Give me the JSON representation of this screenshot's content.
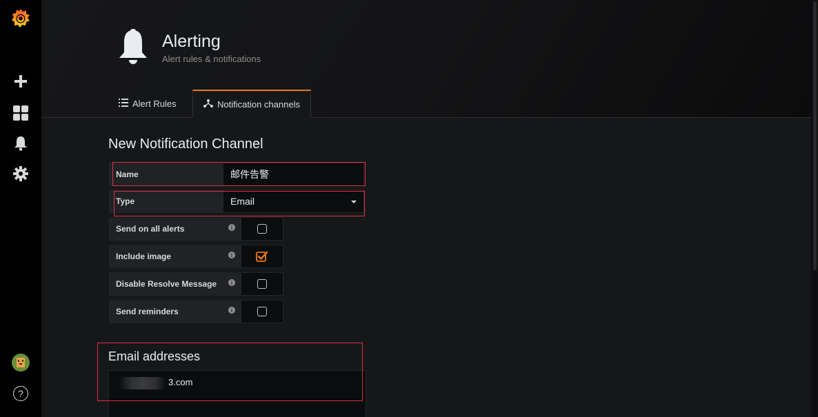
{
  "header": {
    "title": "Alerting",
    "subtitle": "Alert rules & notifications"
  },
  "tabs": [
    {
      "label": "Alert Rules",
      "icon": "list-icon",
      "active": false
    },
    {
      "label": "Notification channels",
      "icon": "share-icon",
      "active": true
    }
  ],
  "sidebar": {
    "items": [
      "grafana-logo",
      "plus-icon",
      "dashboards-icon",
      "bell-icon",
      "gear-icon",
      "avatar",
      "help-icon"
    ],
    "help_glyph": "?"
  },
  "form": {
    "title": "New Notification Channel",
    "name_label": "Name",
    "name_value": "邮件告警",
    "type_label": "Type",
    "type_value": "Email",
    "options": [
      {
        "label": "Send on all alerts",
        "checked": false
      },
      {
        "label": "Include image",
        "checked": true
      },
      {
        "label": "Disable Resolve Message",
        "checked": false
      },
      {
        "label": "Send reminders",
        "checked": false
      }
    ],
    "info_glyph": "i"
  },
  "email": {
    "title": "Email addresses",
    "value_visible": "3.com"
  },
  "colors": {
    "accent": "#eb7b18",
    "highlight_border": "#e02f44",
    "background": "#161719",
    "sidebar": "#000000"
  }
}
